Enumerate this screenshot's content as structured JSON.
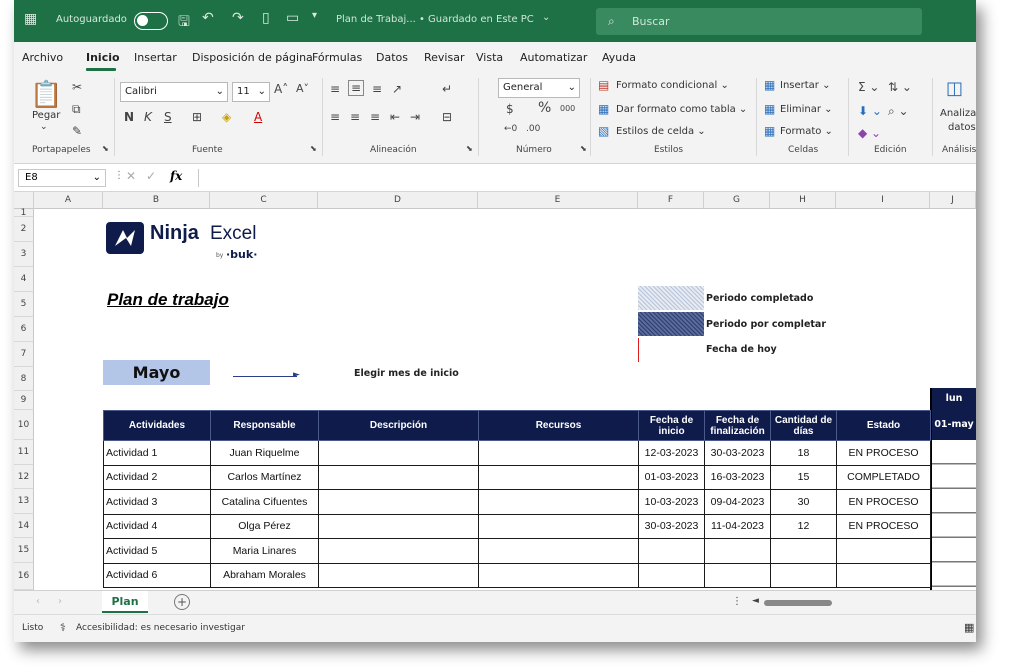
{
  "titlebar": {
    "autosave_label": "Autoguardado",
    "doc_title": "Plan de Trabaj...  •  Guardado en Este PC",
    "search_placeholder": "Buscar"
  },
  "menu": [
    "Archivo",
    "Inicio",
    "Insertar",
    "Disposición de página",
    "Fórmulas",
    "Datos",
    "Revisar",
    "Vista",
    "Automatizar",
    "Ayuda"
  ],
  "ribbon": {
    "paste_label": "Pegar",
    "font_name": "Calibri",
    "font_size": "11",
    "number_format": "General",
    "conditional_format": "Formato condicional",
    "format_as_table": "Dar formato como tabla",
    "cell_styles": "Estilos de celda",
    "insert": "Insertar",
    "delete": "Eliminar",
    "format": "Formato",
    "analyze_1": "Analizar",
    "analyze_2": "datos",
    "groups": {
      "clipboard": "Portapapeles",
      "font": "Fuente",
      "alignment": "Alineación",
      "number": "Número",
      "styles": "Estilos",
      "cells": "Celdas",
      "editing": "Edición",
      "analysis": "Análisis"
    }
  },
  "formula_bar": {
    "name_box": "E8",
    "fx": "fx"
  },
  "columns": [
    "A",
    "B",
    "C",
    "D",
    "E",
    "F",
    "G",
    "H",
    "I",
    "J"
  ],
  "rows": [
    "1",
    "2",
    "3",
    "4",
    "5",
    "6",
    "7",
    "8",
    "9",
    "10",
    "11",
    "12",
    "13",
    "14",
    "15",
    "16"
  ],
  "sheet": {
    "logo_brand": "Ninja",
    "logo_product": "Excel",
    "logo_by": "by",
    "logo_buk": "·buk·",
    "plan_title": "Plan de trabajo",
    "month": "Mayo",
    "choose_month": "Elegir mes de inicio",
    "legend": {
      "completed": "Periodo completado",
      "pending": "Periodo por completar",
      "today": "Fecha de hoy"
    },
    "day_name": "lun",
    "day_date": "01-may"
  },
  "table": {
    "headers": {
      "activities": "Actividades",
      "owner": "Responsable",
      "description": "Descripción",
      "resources": "Recursos",
      "start_1": "Fecha de",
      "start_2": "inicio",
      "end_1": "Fecha de",
      "end_2": "finalización",
      "days_1": "Cantidad de",
      "days_2": "días",
      "status": "Estado"
    },
    "rows": [
      {
        "act": "Actividad 1",
        "owner": "Juan Riquelme",
        "start": "12-03-2023",
        "end": "30-03-2023",
        "days": "18",
        "status": "EN PROCESO"
      },
      {
        "act": "Actividad 2",
        "owner": "Carlos Martínez",
        "start": "01-03-2023",
        "end": "16-03-2023",
        "days": "15",
        "status": "COMPLETADO"
      },
      {
        "act": "Actividad 3",
        "owner": "Catalina Cifuentes",
        "start": "10-03-2023",
        "end": "09-04-2023",
        "days": "30",
        "status": "EN PROCESO"
      },
      {
        "act": "Actividad 4",
        "owner": "Olga Pérez",
        "start": "30-03-2023",
        "end": "11-04-2023",
        "days": "12",
        "status": "EN PROCESO"
      },
      {
        "act": "Actividad 5",
        "owner": "Maria Linares",
        "start": "",
        "end": "",
        "days": "",
        "status": ""
      },
      {
        "act": "Actividad 6",
        "owner": "Abraham Morales",
        "start": "",
        "end": "",
        "days": "",
        "status": ""
      }
    ]
  },
  "tabs": {
    "sheet_tab": "Plan",
    "add": "+"
  },
  "status": {
    "ready": "Listo",
    "accessibility": "Accesibilidad: es necesario investigar"
  },
  "colors": {
    "excel_green": "#1e7145",
    "table_header": "#0f1b4a",
    "month_bg": "#b4c6e7",
    "today_line": "#e02020"
  }
}
